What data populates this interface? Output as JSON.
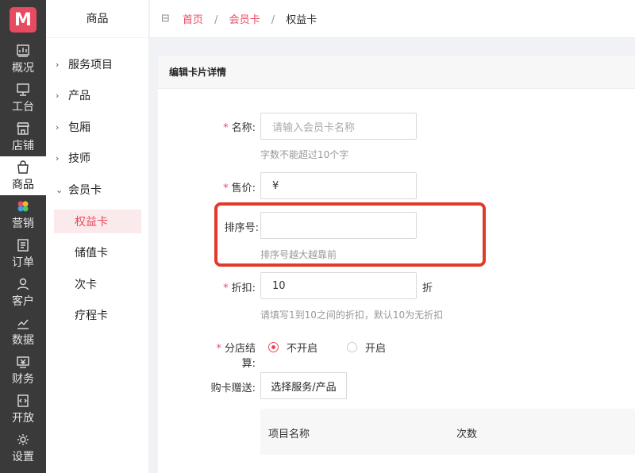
{
  "rail": {
    "logo": "M",
    "items": [
      {
        "label": "概况",
        "icon": "chart-icon"
      },
      {
        "label": "工台",
        "icon": "monitor-icon"
      },
      {
        "label": "店铺",
        "icon": "store-icon"
      },
      {
        "label": "商品",
        "icon": "bag-icon"
      },
      {
        "label": "营销",
        "icon": "palette-icon"
      },
      {
        "label": "订单",
        "icon": "order-icon"
      },
      {
        "label": "客户",
        "icon": "user-icon"
      },
      {
        "label": "数据",
        "icon": "data-icon"
      },
      {
        "label": "财务",
        "icon": "finance-icon"
      },
      {
        "label": "开放",
        "icon": "code-icon"
      },
      {
        "label": "设置",
        "icon": "gear-icon"
      }
    ]
  },
  "sidebar": {
    "title": "商品",
    "groups": [
      {
        "label": "服务项目"
      },
      {
        "label": "产品"
      },
      {
        "label": "包厢"
      },
      {
        "label": "技师"
      },
      {
        "label": "会员卡"
      }
    ],
    "sub_items": [
      {
        "label": "权益卡"
      },
      {
        "label": "储值卡"
      },
      {
        "label": "次卡"
      },
      {
        "label": "疗程卡"
      }
    ]
  },
  "breadcrumb": {
    "home": "首页",
    "level2": "会员卡",
    "current": "权益卡",
    "separator": "/"
  },
  "form": {
    "title": "编辑卡片详情",
    "name_label": "名称:",
    "name_placeholder": "请输入会员卡名称",
    "name_hint": "字数不能超过10个字",
    "price_label": "售价:",
    "price_value": "¥",
    "sort_label": "排序号:",
    "sort_value": "",
    "sort_hint": "排序号越大越靠前",
    "discount_label": "折扣:",
    "discount_value": "10",
    "discount_suffix": "折",
    "discount_hint": "请填写1到10之间的折扣，默认10为无折扣",
    "branch_label": "分店结算:",
    "branch_off": "不开启",
    "branch_on": "开启",
    "gift_label": "购卡赠送:",
    "gift_button": "选择服务/产品",
    "table_col1": "项目名称",
    "table_col2": "次数"
  }
}
